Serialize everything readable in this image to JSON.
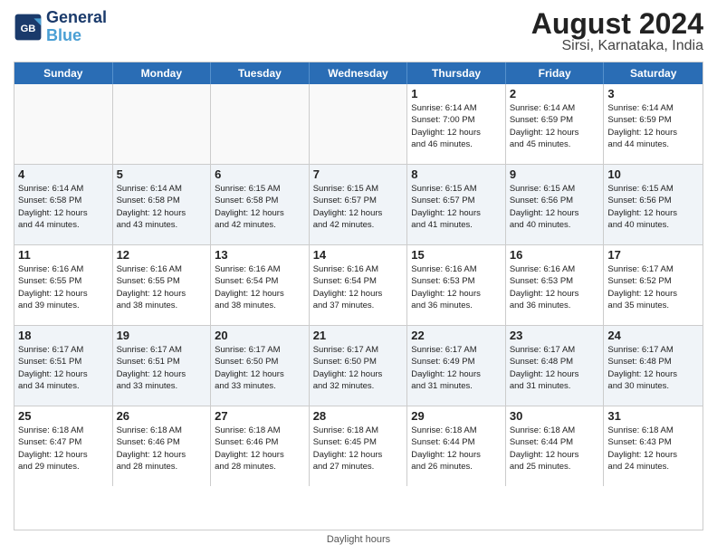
{
  "header": {
    "logo_line1": "General",
    "logo_line2": "Blue",
    "title": "August 2024",
    "subtitle": "Sirsi, Karnataka, India"
  },
  "days_of_week": [
    "Sunday",
    "Monday",
    "Tuesday",
    "Wednesday",
    "Thursday",
    "Friday",
    "Saturday"
  ],
  "footer": "Daylight hours",
  "weeks": [
    [
      {
        "day": "",
        "info": ""
      },
      {
        "day": "",
        "info": ""
      },
      {
        "day": "",
        "info": ""
      },
      {
        "day": "",
        "info": ""
      },
      {
        "day": "1",
        "info": "Sunrise: 6:14 AM\nSunset: 7:00 PM\nDaylight: 12 hours\nand 46 minutes."
      },
      {
        "day": "2",
        "info": "Sunrise: 6:14 AM\nSunset: 6:59 PM\nDaylight: 12 hours\nand 45 minutes."
      },
      {
        "day": "3",
        "info": "Sunrise: 6:14 AM\nSunset: 6:59 PM\nDaylight: 12 hours\nand 44 minutes."
      }
    ],
    [
      {
        "day": "4",
        "info": "Sunrise: 6:14 AM\nSunset: 6:58 PM\nDaylight: 12 hours\nand 44 minutes."
      },
      {
        "day": "5",
        "info": "Sunrise: 6:14 AM\nSunset: 6:58 PM\nDaylight: 12 hours\nand 43 minutes."
      },
      {
        "day": "6",
        "info": "Sunrise: 6:15 AM\nSunset: 6:58 PM\nDaylight: 12 hours\nand 42 minutes."
      },
      {
        "day": "7",
        "info": "Sunrise: 6:15 AM\nSunset: 6:57 PM\nDaylight: 12 hours\nand 42 minutes."
      },
      {
        "day": "8",
        "info": "Sunrise: 6:15 AM\nSunset: 6:57 PM\nDaylight: 12 hours\nand 41 minutes."
      },
      {
        "day": "9",
        "info": "Sunrise: 6:15 AM\nSunset: 6:56 PM\nDaylight: 12 hours\nand 40 minutes."
      },
      {
        "day": "10",
        "info": "Sunrise: 6:15 AM\nSunset: 6:56 PM\nDaylight: 12 hours\nand 40 minutes."
      }
    ],
    [
      {
        "day": "11",
        "info": "Sunrise: 6:16 AM\nSunset: 6:55 PM\nDaylight: 12 hours\nand 39 minutes."
      },
      {
        "day": "12",
        "info": "Sunrise: 6:16 AM\nSunset: 6:55 PM\nDaylight: 12 hours\nand 38 minutes."
      },
      {
        "day": "13",
        "info": "Sunrise: 6:16 AM\nSunset: 6:54 PM\nDaylight: 12 hours\nand 38 minutes."
      },
      {
        "day": "14",
        "info": "Sunrise: 6:16 AM\nSunset: 6:54 PM\nDaylight: 12 hours\nand 37 minutes."
      },
      {
        "day": "15",
        "info": "Sunrise: 6:16 AM\nSunset: 6:53 PM\nDaylight: 12 hours\nand 36 minutes."
      },
      {
        "day": "16",
        "info": "Sunrise: 6:16 AM\nSunset: 6:53 PM\nDaylight: 12 hours\nand 36 minutes."
      },
      {
        "day": "17",
        "info": "Sunrise: 6:17 AM\nSunset: 6:52 PM\nDaylight: 12 hours\nand 35 minutes."
      }
    ],
    [
      {
        "day": "18",
        "info": "Sunrise: 6:17 AM\nSunset: 6:51 PM\nDaylight: 12 hours\nand 34 minutes."
      },
      {
        "day": "19",
        "info": "Sunrise: 6:17 AM\nSunset: 6:51 PM\nDaylight: 12 hours\nand 33 minutes."
      },
      {
        "day": "20",
        "info": "Sunrise: 6:17 AM\nSunset: 6:50 PM\nDaylight: 12 hours\nand 33 minutes."
      },
      {
        "day": "21",
        "info": "Sunrise: 6:17 AM\nSunset: 6:50 PM\nDaylight: 12 hours\nand 32 minutes."
      },
      {
        "day": "22",
        "info": "Sunrise: 6:17 AM\nSunset: 6:49 PM\nDaylight: 12 hours\nand 31 minutes."
      },
      {
        "day": "23",
        "info": "Sunrise: 6:17 AM\nSunset: 6:48 PM\nDaylight: 12 hours\nand 31 minutes."
      },
      {
        "day": "24",
        "info": "Sunrise: 6:17 AM\nSunset: 6:48 PM\nDaylight: 12 hours\nand 30 minutes."
      }
    ],
    [
      {
        "day": "25",
        "info": "Sunrise: 6:18 AM\nSunset: 6:47 PM\nDaylight: 12 hours\nand 29 minutes."
      },
      {
        "day": "26",
        "info": "Sunrise: 6:18 AM\nSunset: 6:46 PM\nDaylight: 12 hours\nand 28 minutes."
      },
      {
        "day": "27",
        "info": "Sunrise: 6:18 AM\nSunset: 6:46 PM\nDaylight: 12 hours\nand 28 minutes."
      },
      {
        "day": "28",
        "info": "Sunrise: 6:18 AM\nSunset: 6:45 PM\nDaylight: 12 hours\nand 27 minutes."
      },
      {
        "day": "29",
        "info": "Sunrise: 6:18 AM\nSunset: 6:44 PM\nDaylight: 12 hours\nand 26 minutes."
      },
      {
        "day": "30",
        "info": "Sunrise: 6:18 AM\nSunset: 6:44 PM\nDaylight: 12 hours\nand 25 minutes."
      },
      {
        "day": "31",
        "info": "Sunrise: 6:18 AM\nSunset: 6:43 PM\nDaylight: 12 hours\nand 24 minutes."
      }
    ]
  ]
}
